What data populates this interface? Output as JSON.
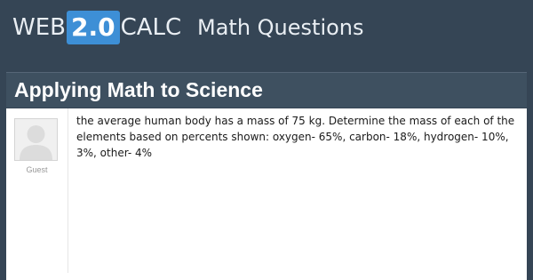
{
  "header": {
    "logo": {
      "part1": "WEB",
      "badge": "2.0",
      "part2": "CALC"
    },
    "section_title": "Math Questions"
  },
  "page": {
    "title": "Applying Math to Science"
  },
  "post": {
    "author": "Guest",
    "text_lines": [
      "the average human body has a mass of 75 kg. Determine the mass of each of the",
      "elements based on percents shown: oxygen- 65%, carbon- 18%, hydrogen- 10%,",
      "3%, other- 4%"
    ]
  },
  "colors": {
    "background": "#354555",
    "title_bar": "#3e5060",
    "logo_badge": "#3d8fd6",
    "card": "#ffffff"
  },
  "icons": {
    "avatar": "user-silhouette-icon"
  }
}
